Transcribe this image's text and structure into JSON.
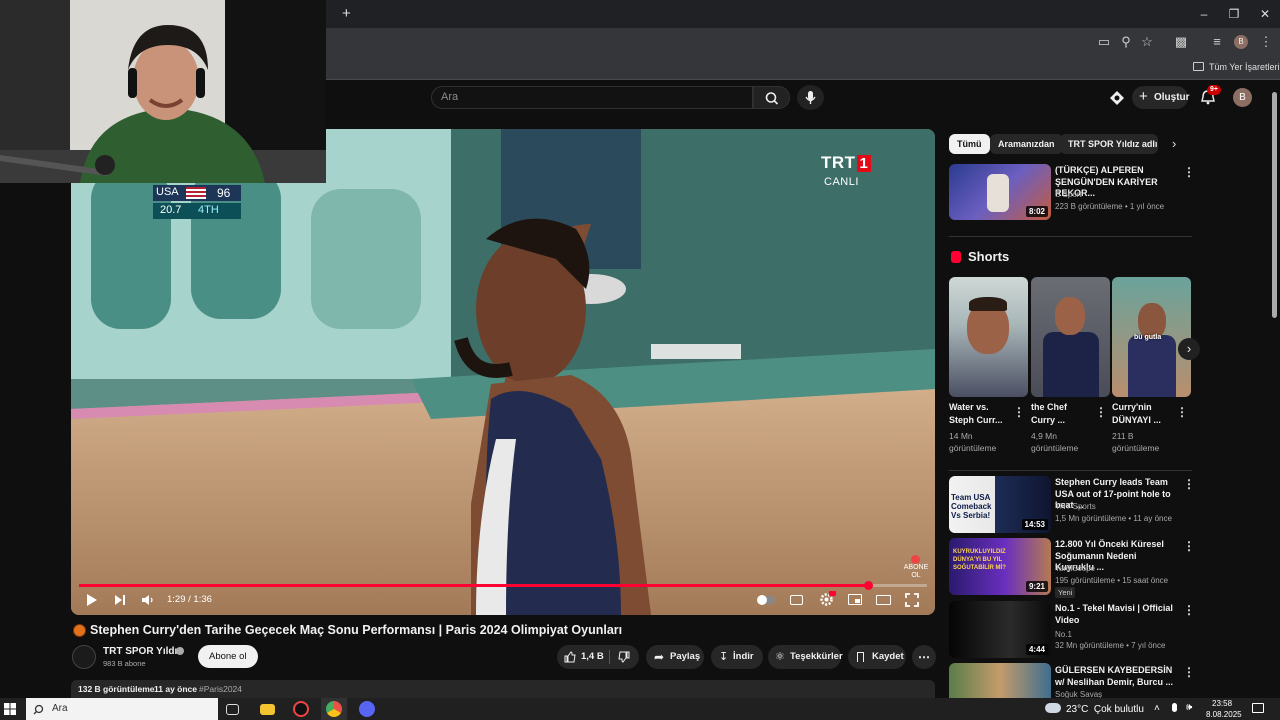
{
  "browser": {
    "new_tab_symbol": "+",
    "bookmarks_label": "Tüm Yer İşaretleri",
    "profile_initial": "B"
  },
  "header": {
    "search_placeholder": "Ara",
    "create_label": "Oluştur",
    "notifications_badge": "9+",
    "avatar_initial": "B"
  },
  "video": {
    "scoreboard_team": "USA",
    "scoreboard_score": "96",
    "scoreboard_clock": "20.7",
    "scoreboard_period": "4TH",
    "channel_bug": "TRT",
    "channel_bug_num": "1",
    "live_label": "CANLI",
    "subscribe_overlay": "ABONE OL",
    "time_display": "1:29 / 1:36",
    "progress_fraction": 0.93
  },
  "info": {
    "title": "Stephen Curry'den Tarihe Geçecek Maç Sonu Performansı | Paris 2024 Olimpiyat Oyunları",
    "channel_name": "TRT SPOR Yıldız",
    "subscribers": "983 B abone",
    "subscribe_label": "Abone ol",
    "likes": "1,4 B",
    "share_label": "Paylaş",
    "download_label": "İndir",
    "thanks_label": "Teşekkürler",
    "save_label": "Kaydet",
    "views": "132 B görüntüleme",
    "age": "11 ay önce",
    "hashtag": "#Paris2024"
  },
  "sidebar": {
    "chips": [
      "Tümü",
      "Aramanızdan",
      "TRT SPOR Yıldız adlı yük"
    ],
    "top_video": {
      "title": "(TÜRKÇE) ALPEREN ŞENGÜN'DEN KARİYER REKOR...",
      "channel": "S Sport",
      "meta": "223 B görüntüleme • 1 yıl önce",
      "duration": "8:02"
    },
    "shorts_heading": "Shorts",
    "shorts": [
      {
        "title": "Water vs. Steph Curr...",
        "views": "14 Mn görüntüleme"
      },
      {
        "title": "the Chef Curry ...",
        "views": "4,9 Mn görüntüleme"
      },
      {
        "title": "Curry'nin DÜNYAYI ...",
        "views": "211 B görüntüleme",
        "caption": "bu gutla"
      }
    ],
    "videos": [
      {
        "title": "Stephen Curry leads Team USA out of 17-point hole to beat ...",
        "channel": "TNT Sports",
        "meta": "1,5 Mn görüntüleme • 11 ay önce",
        "duration": "14:53",
        "thumb_text": "Team USA Comeback Vs Serbia!"
      },
      {
        "title": "12.800 Yıl Önceki Küresel Soğumanın Nedeni Kuyruklu ...",
        "channel": "TardiScope",
        "meta": "195 görüntüleme • 15 saat önce",
        "badge": "Yeni",
        "duration": "9:21",
        "thumb_text": "KUYRUKLUYILDIZ DÜNYA'YI BU YIL SOĞUTABİLİR Mİ?"
      },
      {
        "title": "No.1 - Tekel Mavisi | Official Video",
        "channel": "No.1",
        "meta": "32 Mn görüntüleme • 7 yıl önce",
        "duration": "4:44"
      },
      {
        "title": "GÜLERSEN KAYBEDERSİN w/ Neslihan Demir, Burcu ...",
        "channel": "Soğuk Savaş",
        "meta": ""
      }
    ]
  },
  "taskbar": {
    "search_placeholder": "Ara",
    "weather": "23°C  Çok bulutlu",
    "time": "23:58",
    "date": "8.08.2025"
  },
  "colors": {
    "accent_red": "#ff0033",
    "background": "#0f0f0f",
    "chip_active_bg": "#f1f1f1"
  }
}
